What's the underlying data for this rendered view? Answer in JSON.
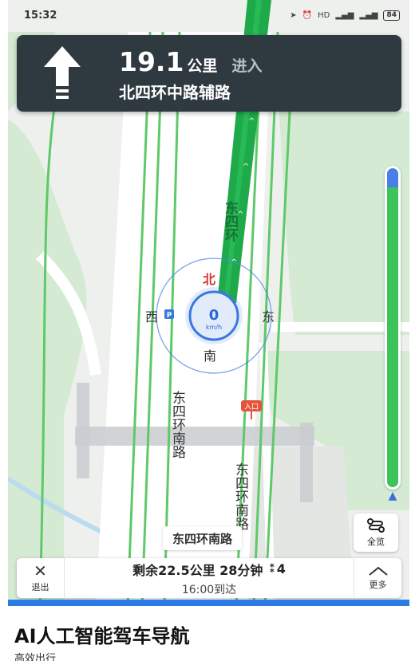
{
  "status_bar": {
    "time": "15:32",
    "signal_label": "HD",
    "battery": "84"
  },
  "nav_card": {
    "distance": "19.1",
    "unit": "公里",
    "action": "进入",
    "road": "北四环中路辅路",
    "turn_icon": "arrow-straight-up-icon"
  },
  "map": {
    "speed_value": "0",
    "speed_unit": "km/h",
    "compass": {
      "north": "北",
      "south": "南",
      "east": "东",
      "west": "西"
    },
    "road_labels": {
      "upper_highlighted": "东四环",
      "lower_left": "东四环南路",
      "lower_right": "东四环南路"
    },
    "entrance_label": "入口",
    "current_road": "东四环南路",
    "route_color": "#1faa4a",
    "road_color": "#5fc96a"
  },
  "progress": {
    "remaining_fraction": 0.94
  },
  "overview_button": {
    "label": "全览"
  },
  "bottom_bar": {
    "exit_label": "退出",
    "remaining": "剩余22.5公里 28分钟",
    "traffic_lights": "4",
    "arrival": "16:00到达",
    "more_label": "更多"
  },
  "article": {
    "title": "AI人工智能驾车导航",
    "subtitle": "高效出行"
  }
}
